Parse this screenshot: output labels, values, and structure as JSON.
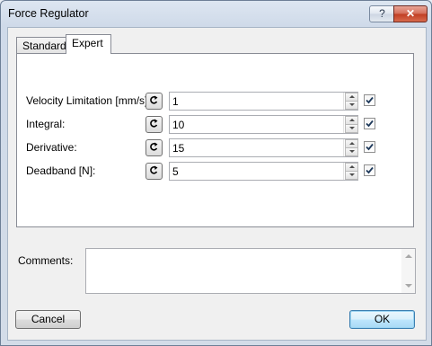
{
  "window": {
    "title": "Force Regulator",
    "help_glyph": "?",
    "close_glyph": "✕"
  },
  "tabs": [
    {
      "label": "Standard",
      "selected": false
    },
    {
      "label": "Expert",
      "selected": true
    }
  ],
  "parameters": [
    {
      "label": "Velocity Limitation [mm/s]:",
      "value": "1",
      "checked": true
    },
    {
      "label": "Integral:",
      "value": "10",
      "checked": true
    },
    {
      "label": "Derivative:",
      "value": "15",
      "checked": true
    },
    {
      "label": "Deadband [N]:",
      "value": "5",
      "checked": true
    }
  ],
  "comments": {
    "label": "Comments:",
    "value": ""
  },
  "buttons": {
    "cancel": "Cancel",
    "ok": "OK"
  },
  "icons": {
    "reset": "reset-arrow-icon",
    "check": "checkmark-icon"
  },
  "colors": {
    "ok_border": "#3c7fb1",
    "close_button": "#c03d23"
  }
}
